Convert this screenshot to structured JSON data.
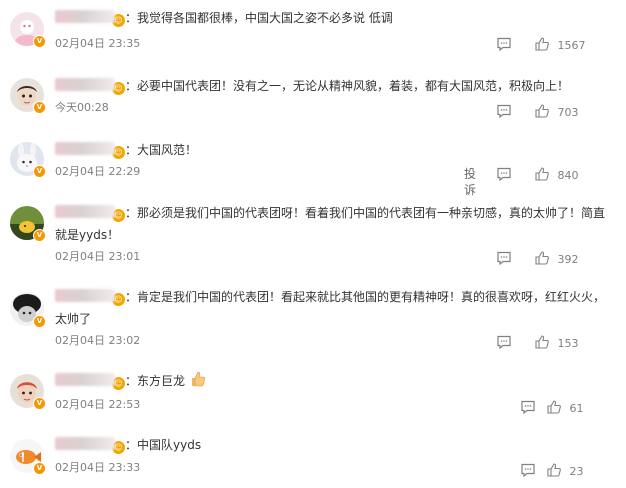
{
  "comments": [
    {
      "text": "：我觉得各国都很棒，中国大国之姿不必多说 低调",
      "time": "02月04日 23:35",
      "likes": "1567"
    },
    {
      "text": "：必要中国代表团！没有之一，无论从精神风貌，着装，都有大国风范，积极向上！",
      "time": "今天00:28",
      "likes": "703"
    },
    {
      "text": "：大国风范！",
      "time": "02月04日 22:29",
      "report_label": "投诉",
      "likes": "840"
    },
    {
      "text": "：那必须是我们中国的代表团呀！看着我们中国的代表团有一种亲切感，真的太帅了！简直就是yyds！",
      "time": "02月04日 23:01",
      "likes": "392"
    },
    {
      "text": "：肯定是我们中国的代表团！看起来就比其他国的更有精神呀！真的很喜欢呀，红红火火，太帅了",
      "time": "02月04日 23:02",
      "likes": "153"
    },
    {
      "text": "：东方巨龙",
      "time": "02月04日 22:53",
      "likes": "61"
    },
    {
      "text": "：中国队yyds",
      "time": "02月04日 23:33",
      "likes": "23"
    }
  ],
  "icons": {
    "comment": "comment-icon",
    "like": "thumbs-up-icon",
    "verified": "verified-badge-icon",
    "thumbs_emoji": "thumbs-up-emoji"
  },
  "colors": {
    "text": "#333333",
    "meta": "#808080",
    "badge": "#f39800"
  }
}
